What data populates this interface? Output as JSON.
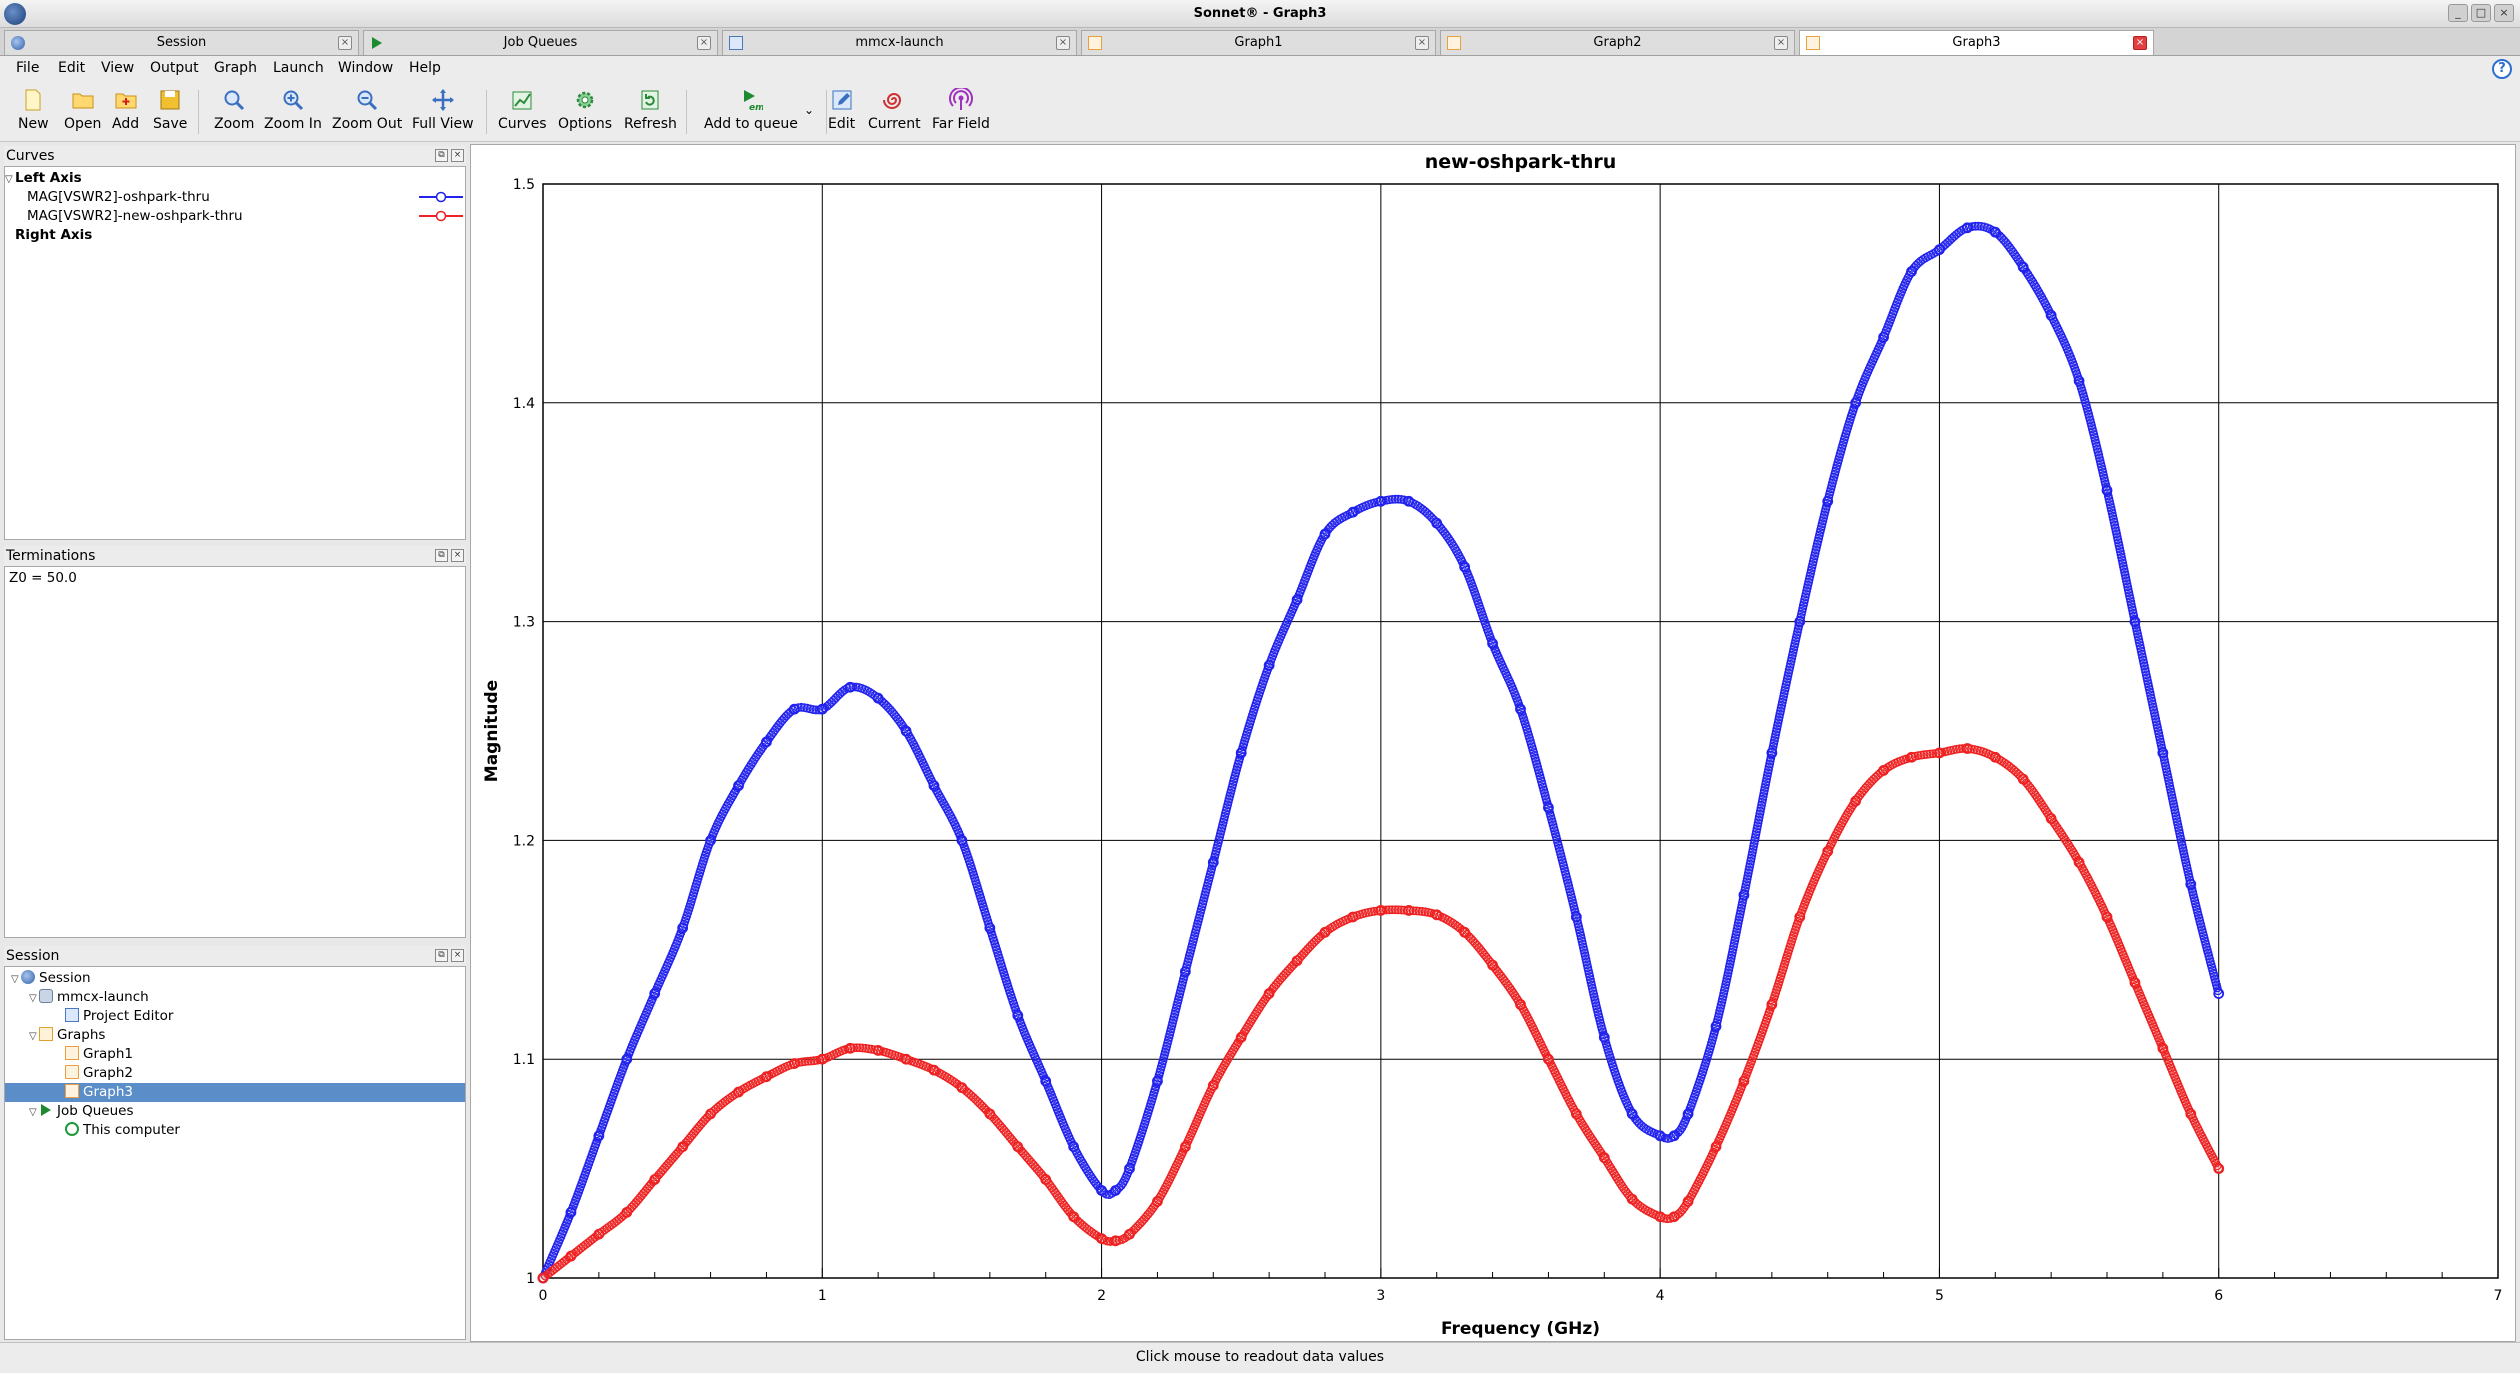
{
  "window": {
    "title": "Sonnet® - Graph3",
    "buttons": [
      "_",
      "□",
      "×"
    ]
  },
  "tabs": [
    {
      "label": "Session",
      "icon": "session-icon",
      "active": false
    },
    {
      "label": "Job Queues",
      "icon": "job-queue-icon",
      "active": false
    },
    {
      "label": "mmcx-launch",
      "icon": "project-editor-icon",
      "active": false
    },
    {
      "label": "Graph1",
      "icon": "graph-icon",
      "active": false
    },
    {
      "label": "Graph2",
      "icon": "graph-icon",
      "active": false
    },
    {
      "label": "Graph3",
      "icon": "graph-icon",
      "active": true
    }
  ],
  "menu": [
    "File",
    "Edit",
    "View",
    "Output",
    "Graph",
    "Launch",
    "Window",
    "Help"
  ],
  "toolbar": {
    "new": "New",
    "open": "Open",
    "add": "Add",
    "save": "Save",
    "zoom": "Zoom",
    "zoom_in": "Zoom In",
    "zoom_out": "Zoom Out",
    "full_view": "Full View",
    "curves": "Curves",
    "options": "Options",
    "refresh": "Refresh",
    "add_to_queue": "Add to queue",
    "edit": "Edit",
    "current": "Current",
    "far_field": "Far Field",
    "em_badge": "em"
  },
  "panels": {
    "curves": {
      "title": "Curves",
      "left_axis": "Left Axis",
      "right_axis": "Right Axis",
      "items": [
        {
          "label": "MAG[VSWR2]-oshpark-thru",
          "color": "#2222ee"
        },
        {
          "label": "MAG[VSWR2]-new-oshpark-thru",
          "color": "#ee2222"
        }
      ]
    },
    "terminations": {
      "title": "Terminations",
      "value": "Z0 = 50.0"
    },
    "session": {
      "title": "Session",
      "root": "Session",
      "project": "mmcx-launch",
      "project_editor": "Project Editor",
      "graphs": "Graphs",
      "graph_items": [
        "Graph1",
        "Graph2",
        "Graph3"
      ],
      "job_queues": "Job Queues",
      "this_computer": "This computer"
    }
  },
  "status": "Click mouse to readout data values",
  "chart_data": {
    "type": "scatter",
    "title": "new-oshpark-thru",
    "xlabel": "Frequency (GHz)",
    "ylabel": "Magnitude",
    "xlim": [
      0,
      7
    ],
    "ylim": [
      1,
      1.5
    ],
    "xticks": [
      0,
      1,
      2,
      3,
      4,
      5,
      6,
      7
    ],
    "yticks": [
      1,
      1.1,
      1.2,
      1.3,
      1.4,
      1.5
    ],
    "grid": true,
    "series": [
      {
        "name": "MAG[VSWR2]-oshpark-thru",
        "color": "#2222ee",
        "x": [
          0,
          0.1,
          0.2,
          0.3,
          0.4,
          0.5,
          0.6,
          0.7,
          0.8,
          0.9,
          1.0,
          1.1,
          1.2,
          1.3,
          1.4,
          1.5,
          1.6,
          1.7,
          1.8,
          1.9,
          2.0,
          2.05,
          2.1,
          2.2,
          2.3,
          2.4,
          2.5,
          2.6,
          2.7,
          2.8,
          2.9,
          3.0,
          3.1,
          3.2,
          3.3,
          3.4,
          3.5,
          3.6,
          3.7,
          3.8,
          3.9,
          4.0,
          4.05,
          4.1,
          4.2,
          4.3,
          4.4,
          4.5,
          4.6,
          4.7,
          4.8,
          4.9,
          5.0,
          5.1,
          5.2,
          5.3,
          5.4,
          5.5,
          5.6,
          5.7,
          5.8,
          5.9,
          6.0
        ],
        "y": [
          1.0,
          1.03,
          1.065,
          1.1,
          1.13,
          1.16,
          1.2,
          1.225,
          1.245,
          1.26,
          1.26,
          1.27,
          1.265,
          1.25,
          1.225,
          1.2,
          1.16,
          1.12,
          1.09,
          1.06,
          1.04,
          1.04,
          1.05,
          1.09,
          1.14,
          1.19,
          1.24,
          1.28,
          1.31,
          1.34,
          1.35,
          1.355,
          1.355,
          1.345,
          1.325,
          1.29,
          1.26,
          1.215,
          1.165,
          1.11,
          1.075,
          1.065,
          1.065,
          1.075,
          1.115,
          1.175,
          1.24,
          1.3,
          1.355,
          1.4,
          1.43,
          1.46,
          1.47,
          1.48,
          1.478,
          1.462,
          1.44,
          1.41,
          1.36,
          1.3,
          1.24,
          1.18,
          1.13
        ]
      },
      {
        "name": "MAG[VSWR2]-new-oshpark-thru",
        "color": "#ee2222",
        "x": [
          0,
          0.1,
          0.2,
          0.3,
          0.4,
          0.5,
          0.6,
          0.7,
          0.8,
          0.9,
          1.0,
          1.1,
          1.2,
          1.3,
          1.4,
          1.5,
          1.6,
          1.7,
          1.8,
          1.9,
          2.0,
          2.05,
          2.1,
          2.2,
          2.3,
          2.4,
          2.5,
          2.6,
          2.7,
          2.8,
          2.9,
          3.0,
          3.1,
          3.2,
          3.3,
          3.4,
          3.5,
          3.6,
          3.7,
          3.8,
          3.9,
          4.0,
          4.05,
          4.1,
          4.2,
          4.3,
          4.4,
          4.5,
          4.6,
          4.7,
          4.8,
          4.9,
          5.0,
          5.1,
          5.2,
          5.3,
          5.4,
          5.5,
          5.6,
          5.7,
          5.8,
          5.9,
          6.0
        ],
        "y": [
          1.0,
          1.01,
          1.02,
          1.03,
          1.045,
          1.06,
          1.075,
          1.085,
          1.092,
          1.098,
          1.1,
          1.105,
          1.104,
          1.1,
          1.095,
          1.087,
          1.075,
          1.06,
          1.045,
          1.028,
          1.018,
          1.017,
          1.02,
          1.035,
          1.06,
          1.088,
          1.11,
          1.13,
          1.145,
          1.158,
          1.165,
          1.168,
          1.168,
          1.166,
          1.158,
          1.143,
          1.125,
          1.1,
          1.075,
          1.055,
          1.036,
          1.028,
          1.028,
          1.035,
          1.06,
          1.09,
          1.125,
          1.165,
          1.195,
          1.218,
          1.232,
          1.238,
          1.24,
          1.242,
          1.238,
          1.228,
          1.21,
          1.19,
          1.165,
          1.135,
          1.105,
          1.075,
          1.05
        ]
      }
    ]
  }
}
